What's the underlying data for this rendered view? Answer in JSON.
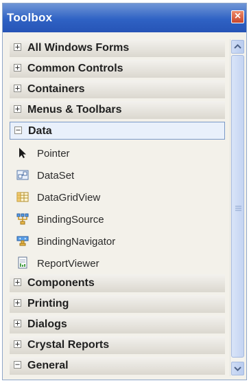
{
  "window": {
    "title": "Toolbox",
    "close_glyph": "×"
  },
  "toolbox": {
    "rows": [
      {
        "type": "category",
        "expander": "+",
        "label": "All Windows Forms",
        "selected": false
      },
      {
        "type": "category",
        "expander": "+",
        "label": "Common Controls",
        "selected": false
      },
      {
        "type": "category",
        "expander": "+",
        "label": "Containers",
        "selected": false
      },
      {
        "type": "category",
        "expander": "+",
        "label": "Menus & Toolbars",
        "selected": false
      },
      {
        "type": "category",
        "expander": "−",
        "label": "Data",
        "selected": true
      },
      {
        "type": "item",
        "label": "Pointer",
        "icon": "pointer-arrow-icon"
      },
      {
        "type": "item",
        "label": "DataSet",
        "icon": "dataset-icon"
      },
      {
        "type": "item",
        "label": "DataGridView",
        "icon": "datagridview-icon"
      },
      {
        "type": "item",
        "label": "BindingSource",
        "icon": "bindingsource-icon"
      },
      {
        "type": "item",
        "label": "BindingNavigator",
        "icon": "bindingnavigator-icon"
      },
      {
        "type": "item",
        "label": "ReportViewer",
        "icon": "reportviewer-icon"
      },
      {
        "type": "category",
        "expander": "+",
        "label": "Components",
        "selected": false
      },
      {
        "type": "category",
        "expander": "+",
        "label": "Printing",
        "selected": false
      },
      {
        "type": "category",
        "expander": "+",
        "label": "Dialogs",
        "selected": false
      },
      {
        "type": "category",
        "expander": "+",
        "label": "Crystal Reports",
        "selected": false
      },
      {
        "type": "category",
        "expander": "−",
        "label": "General",
        "selected": false
      }
    ]
  },
  "colors": {
    "title_bar": "#2f62c4",
    "close_button": "#c8452b",
    "selected_border": "#7a98c6",
    "scrollbar": "#c4d4f2"
  }
}
